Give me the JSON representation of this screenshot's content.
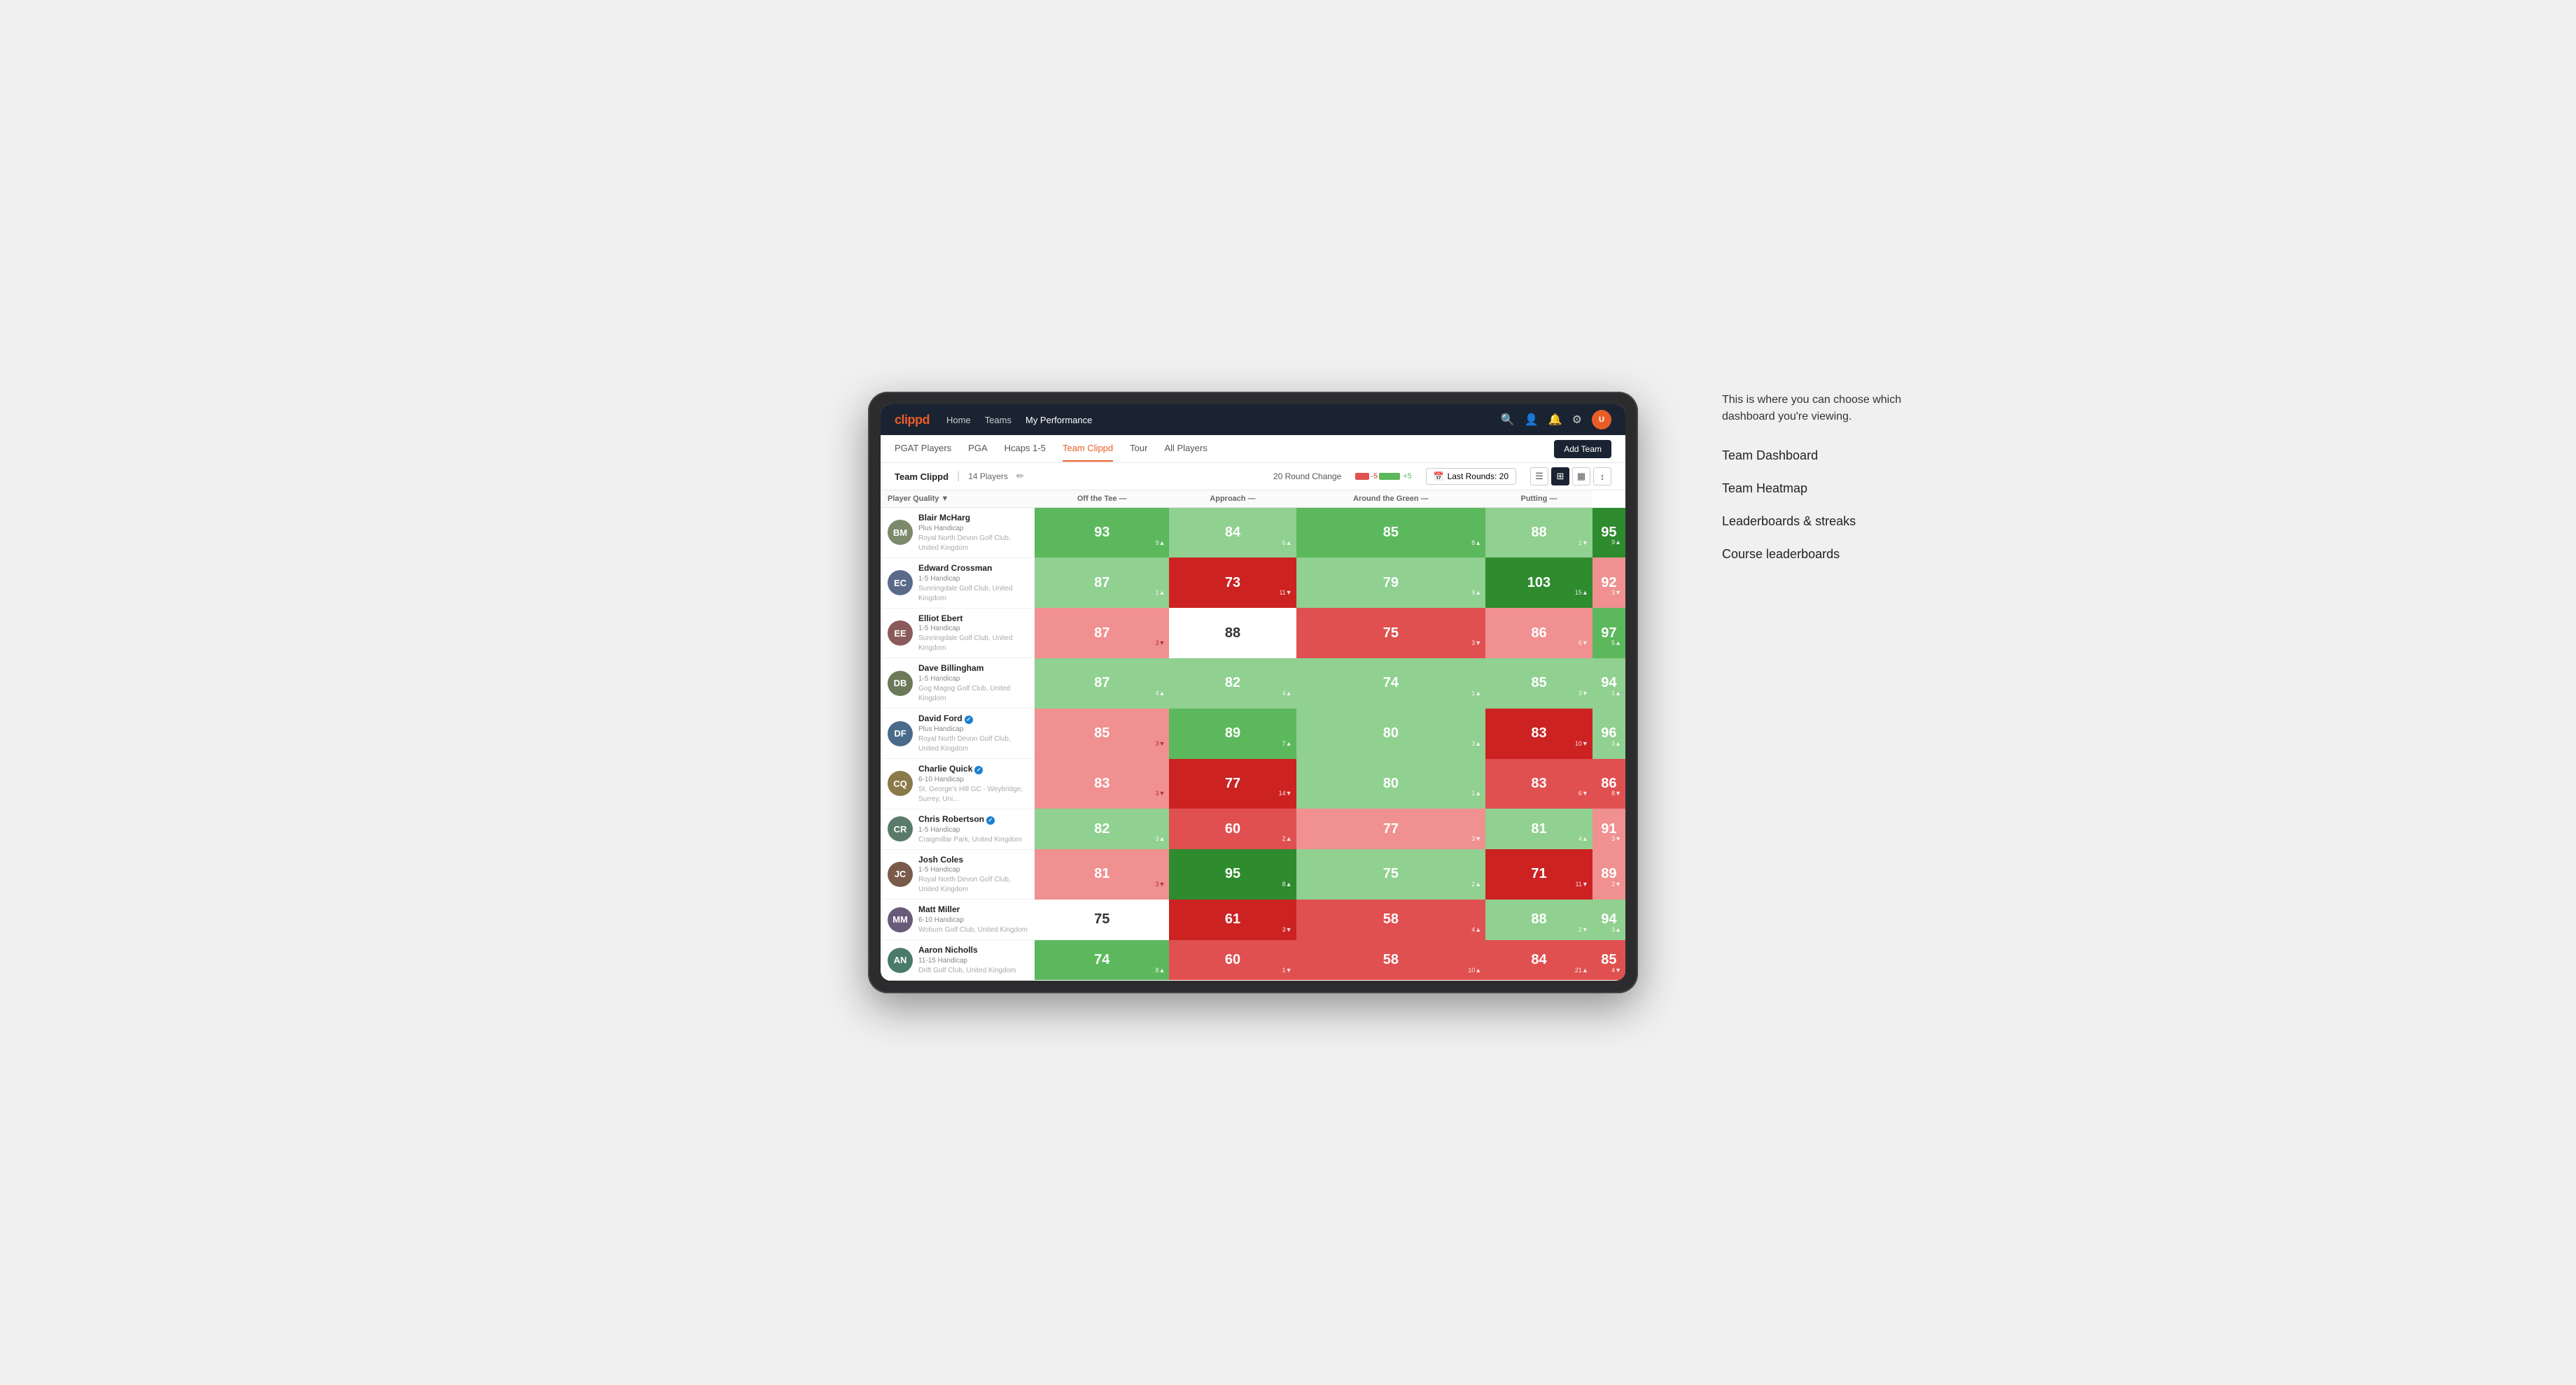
{
  "annotation": {
    "note": "This is where you can choose which dashboard you're viewing.",
    "items": [
      "Team Dashboard",
      "Team Heatmap",
      "Leaderboards & streaks",
      "Course leaderboards"
    ]
  },
  "nav": {
    "logo": "clippd",
    "links": [
      {
        "label": "Home",
        "active": false
      },
      {
        "label": "Teams",
        "active": false
      },
      {
        "label": "My Performance",
        "active": true
      }
    ],
    "icons": [
      "search",
      "person",
      "bell",
      "settings",
      "avatar"
    ]
  },
  "sub_nav": {
    "links": [
      {
        "label": "PGAT Players",
        "active": false
      },
      {
        "label": "PGA",
        "active": false
      },
      {
        "label": "Hcaps 1-5",
        "active": false
      },
      {
        "label": "Team Clippd",
        "active": true
      },
      {
        "label": "Tour",
        "active": false
      },
      {
        "label": "All Players",
        "active": false
      }
    ],
    "add_team": "Add Team"
  },
  "team_bar": {
    "name": "Team Clippd",
    "separator": "|",
    "count": "14 Players",
    "round_change_label": "20 Round Change",
    "round_change_neg": "-5",
    "round_change_pos": "+5",
    "last_rounds_label": "Last Rounds:",
    "last_rounds_value": "20"
  },
  "table": {
    "headers": [
      {
        "label": "Player Quality ▼",
        "align": "left"
      },
      {
        "label": "Off the Tee —",
        "align": "center"
      },
      {
        "label": "Approach —",
        "align": "center"
      },
      {
        "label": "Around the Green —",
        "align": "center"
      },
      {
        "label": "Putting —",
        "align": "center"
      }
    ],
    "players": [
      {
        "name": "Blair McHarg",
        "handicap": "Plus Handicap",
        "club": "Royal North Devon Golf Club, United Kingdom",
        "avatar_color": "#7a8a6a",
        "initials": "BM",
        "scores": [
          {
            "value": "93",
            "change": "9▲",
            "bg": "bg-green-mid",
            "change_class": "white-up"
          },
          {
            "value": "84",
            "change": "6▲",
            "bg": "bg-green-light",
            "change_class": "white-up"
          },
          {
            "value": "85",
            "change": "8▲",
            "bg": "bg-green-mid",
            "change_class": "white-up"
          },
          {
            "value": "88",
            "change": "1▼",
            "bg": "bg-green-light",
            "change_class": "white-down"
          },
          {
            "value": "95",
            "change": "9▲",
            "bg": "bg-green-dark",
            "change_class": "white-up"
          }
        ]
      },
      {
        "name": "Edward Crossman",
        "handicap": "1-5 Handicap",
        "club": "Sunningdale Golf Club, United Kingdom",
        "avatar_color": "#5a6a8a",
        "initials": "EC",
        "scores": [
          {
            "value": "87",
            "change": "1▲",
            "bg": "bg-green-light",
            "change_class": "white-up"
          },
          {
            "value": "73",
            "change": "11▼",
            "bg": "bg-red-dark",
            "change_class": "white-down"
          },
          {
            "value": "79",
            "change": "9▲",
            "bg": "bg-green-light",
            "change_class": "white-up"
          },
          {
            "value": "103",
            "change": "15▲",
            "bg": "bg-green-dark",
            "change_class": "white-up"
          },
          {
            "value": "92",
            "change": "3▼",
            "bg": "bg-red-light",
            "change_class": "white-down"
          }
        ]
      },
      {
        "name": "Elliot Ebert",
        "handicap": "1-5 Handicap",
        "club": "Sunningdale Golf Club, United Kingdom",
        "avatar_color": "#8a5a5a",
        "initials": "EE",
        "scores": [
          {
            "value": "87",
            "change": "3▼",
            "bg": "bg-red-light",
            "change_class": "down"
          },
          {
            "value": "88",
            "change": "",
            "bg": "bg-white",
            "change_class": ""
          },
          {
            "value": "75",
            "change": "3▼",
            "bg": "bg-red-mid",
            "change_class": "white-down"
          },
          {
            "value": "86",
            "change": "6▼",
            "bg": "bg-red-light",
            "change_class": "white-down"
          },
          {
            "value": "97",
            "change": "5▲",
            "bg": "bg-green-mid",
            "change_class": "white-up"
          }
        ]
      },
      {
        "name": "Dave Billingham",
        "handicap": "1-5 Handicap",
        "club": "Gog Magog Golf Club, United Kingdom",
        "avatar_color": "#6a7a5a",
        "initials": "DB",
        "scores": [
          {
            "value": "87",
            "change": "4▲",
            "bg": "bg-green-light",
            "change_class": "white-up"
          },
          {
            "value": "82",
            "change": "4▲",
            "bg": "bg-green-light",
            "change_class": "white-up"
          },
          {
            "value": "74",
            "change": "1▲",
            "bg": "bg-green-light",
            "change_class": "white-up"
          },
          {
            "value": "85",
            "change": "3▼",
            "bg": "bg-green-light",
            "change_class": "white-down"
          },
          {
            "value": "94",
            "change": "1▲",
            "bg": "bg-green-light",
            "change_class": "white-up"
          }
        ]
      },
      {
        "name": "David Ford",
        "handicap": "Plus Handicap",
        "club": "Royal North Devon Golf Club, United Kingdom",
        "avatar_color": "#4a6a8a",
        "initials": "DF",
        "verified": true,
        "scores": [
          {
            "value": "85",
            "change": "3▼",
            "bg": "bg-red-light",
            "change_class": "down"
          },
          {
            "value": "89",
            "change": "7▲",
            "bg": "bg-green-mid",
            "change_class": "white-up"
          },
          {
            "value": "80",
            "change": "3▲",
            "bg": "bg-green-light",
            "change_class": "white-up"
          },
          {
            "value": "83",
            "change": "10▼",
            "bg": "bg-red-dark",
            "change_class": "white-down"
          },
          {
            "value": "96",
            "change": "3▲",
            "bg": "bg-green-light",
            "change_class": "white-up"
          }
        ]
      },
      {
        "name": "Charlie Quick",
        "handicap": "6-10 Handicap",
        "club": "St. George's Hill GC - Weybridge, Surrey, Uni...",
        "avatar_color": "#8a7a4a",
        "initials": "CQ",
        "verified": true,
        "scores": [
          {
            "value": "83",
            "change": "3▼",
            "bg": "bg-red-light",
            "change_class": "down"
          },
          {
            "value": "77",
            "change": "14▼",
            "bg": "bg-red-dark",
            "change_class": "white-down"
          },
          {
            "value": "80",
            "change": "1▲",
            "bg": "bg-green-light",
            "change_class": "white-up"
          },
          {
            "value": "83",
            "change": "6▼",
            "bg": "bg-red-mid",
            "change_class": "white-down"
          },
          {
            "value": "86",
            "change": "8▼",
            "bg": "bg-red-mid",
            "change_class": "white-down"
          }
        ]
      },
      {
        "name": "Chris Robertson",
        "handicap": "1-5 Handicap",
        "club": "Craigmillar Park, United Kingdom",
        "avatar_color": "#5a7a6a",
        "initials": "CR",
        "verified": true,
        "scores": [
          {
            "value": "82",
            "change": "3▲",
            "bg": "bg-green-light",
            "change_class": "white-up"
          },
          {
            "value": "60",
            "change": "2▲",
            "bg": "bg-red-mid",
            "change_class": "white-up"
          },
          {
            "value": "77",
            "change": "3▼",
            "bg": "bg-red-light",
            "change_class": "white-down"
          },
          {
            "value": "81",
            "change": "4▲",
            "bg": "bg-green-light",
            "change_class": "white-up"
          },
          {
            "value": "91",
            "change": "3▼",
            "bg": "bg-red-light",
            "change_class": "white-down"
          }
        ]
      },
      {
        "name": "Josh Coles",
        "handicap": "1-5 Handicap",
        "club": "Royal North Devon Golf Club, United Kingdom",
        "avatar_color": "#7a5a4a",
        "initials": "JC",
        "scores": [
          {
            "value": "81",
            "change": "3▼",
            "bg": "bg-red-light",
            "change_class": "down"
          },
          {
            "value": "95",
            "change": "8▲",
            "bg": "bg-green-dark",
            "change_class": "white-up"
          },
          {
            "value": "75",
            "change": "2▲",
            "bg": "bg-green-light",
            "change_class": "white-up"
          },
          {
            "value": "71",
            "change": "11▼",
            "bg": "bg-red-dark",
            "change_class": "white-down"
          },
          {
            "value": "89",
            "change": "2▼",
            "bg": "bg-red-light",
            "change_class": "white-down"
          }
        ]
      },
      {
        "name": "Matt Miller",
        "handicap": "6-10 Handicap",
        "club": "Woburn Golf Club, United Kingdom",
        "avatar_color": "#6a5a7a",
        "initials": "MM",
        "scores": [
          {
            "value": "75",
            "change": "",
            "bg": "bg-white",
            "change_class": ""
          },
          {
            "value": "61",
            "change": "3▼",
            "bg": "bg-red-dark",
            "change_class": "white-down"
          },
          {
            "value": "58",
            "change": "4▲",
            "bg": "bg-red-mid",
            "change_class": "white-up"
          },
          {
            "value": "88",
            "change": "2▼",
            "bg": "bg-green-light",
            "change_class": "white-down"
          },
          {
            "value": "94",
            "change": "3▲",
            "bg": "bg-green-light",
            "change_class": "white-up"
          }
        ]
      },
      {
        "name": "Aaron Nicholls",
        "handicap": "11-15 Handicap",
        "club": "Drift Golf Club, United Kingdom",
        "avatar_color": "#4a7a6a",
        "initials": "AN",
        "scores": [
          {
            "value": "74",
            "change": "8▲",
            "bg": "bg-green-mid",
            "change_class": "white-up"
          },
          {
            "value": "60",
            "change": "1▼",
            "bg": "bg-red-mid",
            "change_class": "white-down"
          },
          {
            "value": "58",
            "change": "10▲",
            "bg": "bg-red-mid",
            "change_class": "white-up"
          },
          {
            "value": "84",
            "change": "21▲",
            "bg": "bg-red-mid",
            "change_class": "white-up"
          },
          {
            "value": "85",
            "change": "4▼",
            "bg": "bg-red-mid",
            "change_class": "white-down"
          }
        ]
      }
    ]
  }
}
